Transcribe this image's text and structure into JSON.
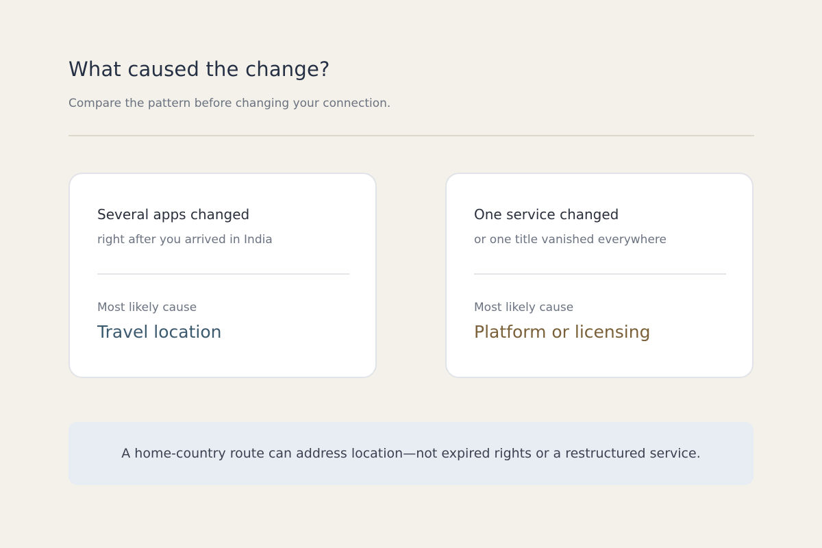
{
  "header": {
    "title": "What caused the change?",
    "subtitle": "Compare the pattern before changing your connection."
  },
  "cards": [
    {
      "title": "Several apps changed",
      "subtitle": "right after you arrived in India",
      "cause_label": "Most likely cause",
      "cause_value": "Travel location",
      "accent_color": "#3c5a6e"
    },
    {
      "title": "One service changed",
      "subtitle": "or one title vanished everywhere",
      "cause_label": "Most likely cause",
      "cause_value": "Platform or licensing",
      "accent_color": "#7a6139"
    }
  ],
  "note": {
    "text": "A home-country route can address location—not expired rights or a restructured service."
  },
  "colors": {
    "background": "#f3f1e9",
    "note_background": "#e8ecf3",
    "card_border": "#e0e3e8"
  }
}
